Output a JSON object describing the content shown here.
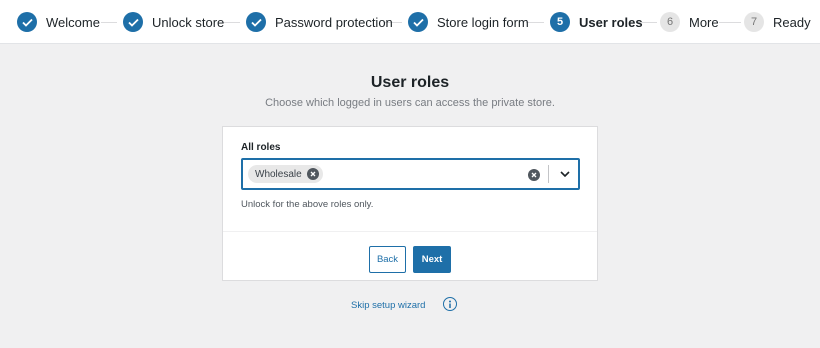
{
  "stepper": {
    "steps": [
      {
        "label": "Welcome",
        "status": "done",
        "icon": "check-icon"
      },
      {
        "label": "Unlock store",
        "status": "done",
        "icon": "check-icon"
      },
      {
        "label": "Password protection",
        "status": "done",
        "icon": "check-icon"
      },
      {
        "label": "Store login form",
        "status": "done",
        "icon": "check-icon"
      },
      {
        "label": "User roles",
        "status": "active",
        "number": "5"
      },
      {
        "label": "More",
        "status": "pending",
        "number": "6"
      },
      {
        "label": "Ready",
        "status": "pending",
        "number": "7"
      }
    ]
  },
  "page": {
    "title": "User roles",
    "subtitle": "Choose which logged in users can access the private store."
  },
  "form": {
    "field_label": "All roles",
    "selected_roles": [
      {
        "label": "Wholesale"
      }
    ],
    "help_text": "Unlock for the above roles only."
  },
  "actions": {
    "back_label": "Back",
    "next_label": "Next"
  },
  "footer": {
    "skip_label": "Skip setup wizard",
    "info_icon": "info-icon"
  },
  "colors": {
    "accent": "#1e6fa8",
    "background": "#f0f0f1",
    "card": "#ffffff"
  }
}
